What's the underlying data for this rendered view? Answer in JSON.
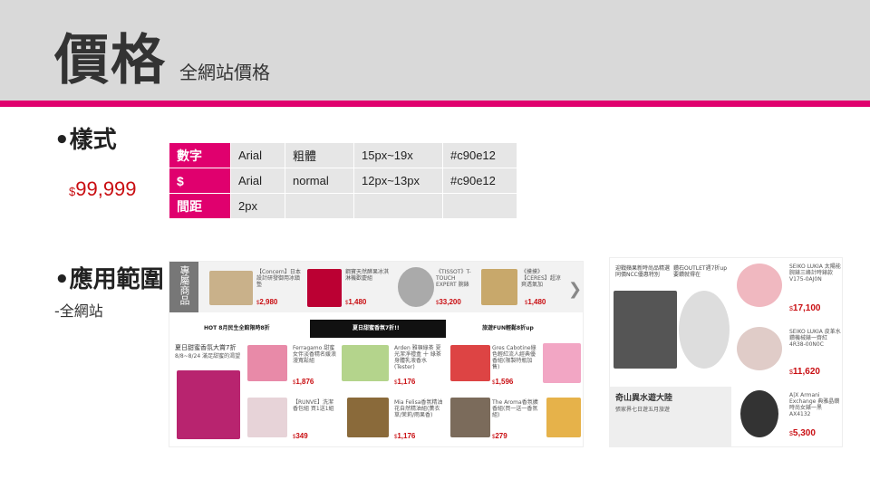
{
  "header": {
    "title": "價格",
    "subtitle": "全網站價格"
  },
  "sections": {
    "style": "•樣式",
    "scope": "•應用範圍",
    "scope_sub": "-全網站"
  },
  "sample": {
    "currency": "$",
    "value": "99,999"
  },
  "spec_table": {
    "rows": [
      {
        "label": "數字",
        "font": "Arial",
        "weight": "粗體",
        "size": "15px~19x",
        "color": "#c90e12"
      },
      {
        "label": "$",
        "font": "Arial",
        "weight": "normal",
        "size": "12px~13px",
        "color": "#c90e12"
      },
      {
        "label": "間距",
        "font": "2px",
        "weight": "",
        "size": "",
        "color": ""
      }
    ]
  },
  "screenshot1": {
    "side_tab": "專屬商品",
    "items": [
      {
        "desc": "【Concern】日本設計研發御用冰鎮墊",
        "currency": "$",
        "price": "2,980"
      },
      {
        "desc": "鋼寶天然酵果冰淇淋機歡慶組",
        "currency": "$",
        "price": "1,480"
      },
      {
        "desc": "《TISSOT》T-TOUCH EXPERT 腕錶",
        "currency": "$",
        "price": "33,200"
      },
      {
        "desc": "《摸摸》【CERES】超涼爽透氣加",
        "currency": "$",
        "price": "1,480"
      }
    ],
    "tabs": [
      "HOT 8月民生全館限時8折",
      "夏日甜蜜香氛7折!!",
      "旅遊FUN輕鬆8折up"
    ],
    "promo": {
      "title": "夏日甜蜜香氛大賞7折",
      "sub": "8/8~8/24 滿足甜蜜的渴望"
    },
    "grid": [
      {
        "desc": "Ferragamo 甜蜜女伴淡香精名媛浪漫寬鬆組",
        "currency": "$",
        "price": "1,876"
      },
      {
        "desc": "Arden 雅頓綠茶 夏光潔淨禮盒 十 綠茶身體乳液香水(Tester)",
        "currency": "$",
        "price": "1,176"
      },
      {
        "desc": "Gres Cabotine綠色輕紅流人經典優香組(限製特瓶加售)",
        "currency": "$",
        "price": "1,596"
      },
      {
        "desc": "【RUNVE】洗潔香包組 買1送1組",
        "currency": "$",
        "price": "349"
      },
      {
        "desc": "Mia Felisa香氛精油花自然精油組(薰衣草/茉莉/雨果香)",
        "currency": "$",
        "price": "1,176"
      },
      {
        "desc": "The Aroma香氛擴香組(買一送一香氛組)",
        "currency": "$",
        "price": "279"
      }
    ]
  },
  "screenshot2": {
    "top1": "迎戰蘋果新時尚品精選同價NCC優惠特別",
    "top2": "鑽石OUTLET週7折up 要鑽就得在",
    "banner": {
      "title": "奇山異水遊大陸",
      "sub": "張家界七日遊五月旅遊"
    },
    "watches": [
      {
        "desc": "SEIKO LUKIA 太陽能腕錶三峰計時錶款 V175-0AJ0N",
        "currency": "$",
        "price": "17,100"
      },
      {
        "desc": "SEIKO LUKIA 皮革水鑽機械錶一齊紅 4R38-00N0C",
        "currency": "$",
        "price": "11,620"
      },
      {
        "desc": "A|X Armani Exchange 典雅晶鑽時尚女錶一黑 AX4132",
        "currency": "$",
        "price": "5,300"
      }
    ]
  }
}
